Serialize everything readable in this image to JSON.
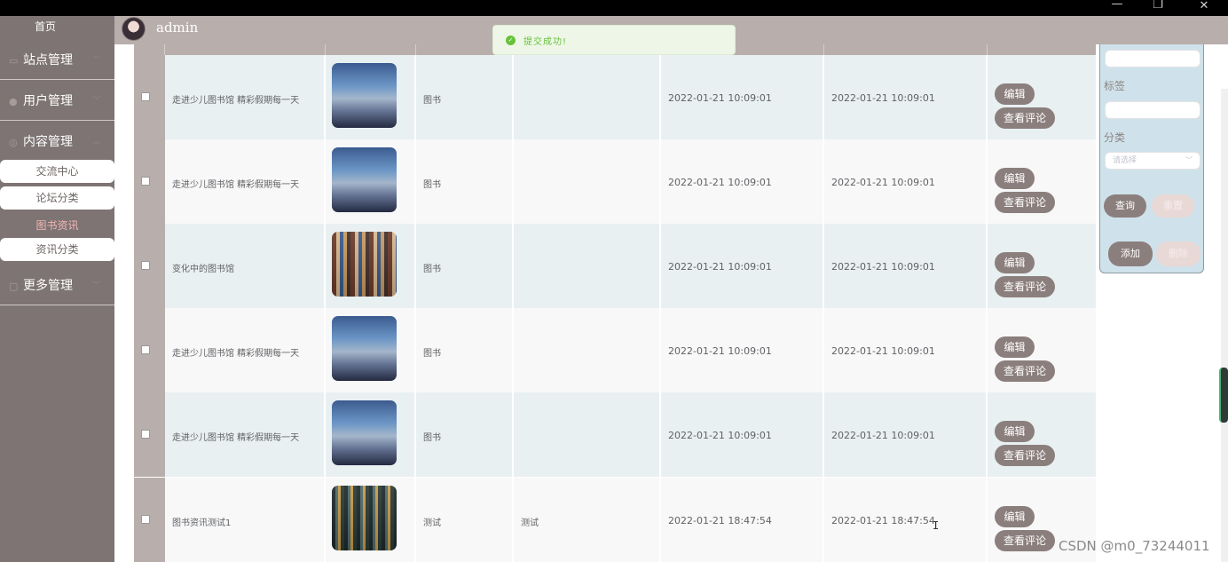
{
  "window": {
    "controls": [
      "—",
      "❐",
      "✕"
    ]
  },
  "sidebar": {
    "home_label": "首页",
    "menus": [
      {
        "label": "站点管理",
        "icon": "monitor-icon"
      },
      {
        "label": "用户管理",
        "icon": "user-icon"
      },
      {
        "label": "内容管理",
        "icon": "document-icon"
      },
      {
        "label": "更多管理",
        "icon": "copy-icon"
      }
    ],
    "submenu": [
      {
        "label": "交流中心"
      },
      {
        "label": "论坛分类"
      },
      {
        "label": "图书资讯",
        "active": true
      },
      {
        "label": "资讯分类"
      }
    ]
  },
  "header": {
    "username": "admin"
  },
  "toast": {
    "message": "提交成功!",
    "color": "#67c23a"
  },
  "table": {
    "rows": [
      {
        "title": "走进少儿图书馆 精彩假期每一天",
        "image": "kid",
        "category": "图书",
        "content": "",
        "created": "2022-01-21 10:09:01",
        "updated": "2022-01-21 10:09:01"
      },
      {
        "title": "走进少儿图书馆 精彩假期每一天",
        "image": "kid",
        "category": "图书",
        "content": "",
        "created": "2022-01-21 10:09:01",
        "updated": "2022-01-21 10:09:01"
      },
      {
        "title": "变化中的图书馆",
        "image": "shelf",
        "category": "图书",
        "content": "",
        "created": "2022-01-21 10:09:01",
        "updated": "2022-01-21 10:09:01"
      },
      {
        "title": "走进少儿图书馆 精彩假期每一天",
        "image": "kid",
        "category": "图书",
        "content": "",
        "created": "2022-01-21 10:09:01",
        "updated": "2022-01-21 10:09:01"
      },
      {
        "title": "走进少儿图书馆 精彩假期每一天",
        "image": "kid",
        "category": "图书",
        "content": "",
        "created": "2022-01-21 10:09:01",
        "updated": "2022-01-21 10:09:01"
      },
      {
        "title": "图书资讯测试1",
        "image": "store",
        "category": "测试",
        "content": "测试",
        "created": "2022-01-21 18:47:54",
        "updated": "2022-01-21 18:47:54"
      }
    ],
    "edit_label": "编辑",
    "view_comments_label": "查看评论"
  },
  "filter_panel": {
    "tag_label": "标签",
    "category_label": "分类",
    "category_placeholder": "请选择",
    "query_label": "查询",
    "reset_label": "重置",
    "add_label": "添加",
    "delete_label": "删除"
  },
  "watermark": "CSDN @m0_73244011",
  "colors": {
    "sidebar_bg": "#7d7473",
    "header_bg": "#b8aeac",
    "button_bg": "#8b7f7d",
    "row_alt_bg": "#e8f0f1",
    "panel_bg": "#cfe2eb",
    "active_menu_text": "#f3b7b7"
  }
}
